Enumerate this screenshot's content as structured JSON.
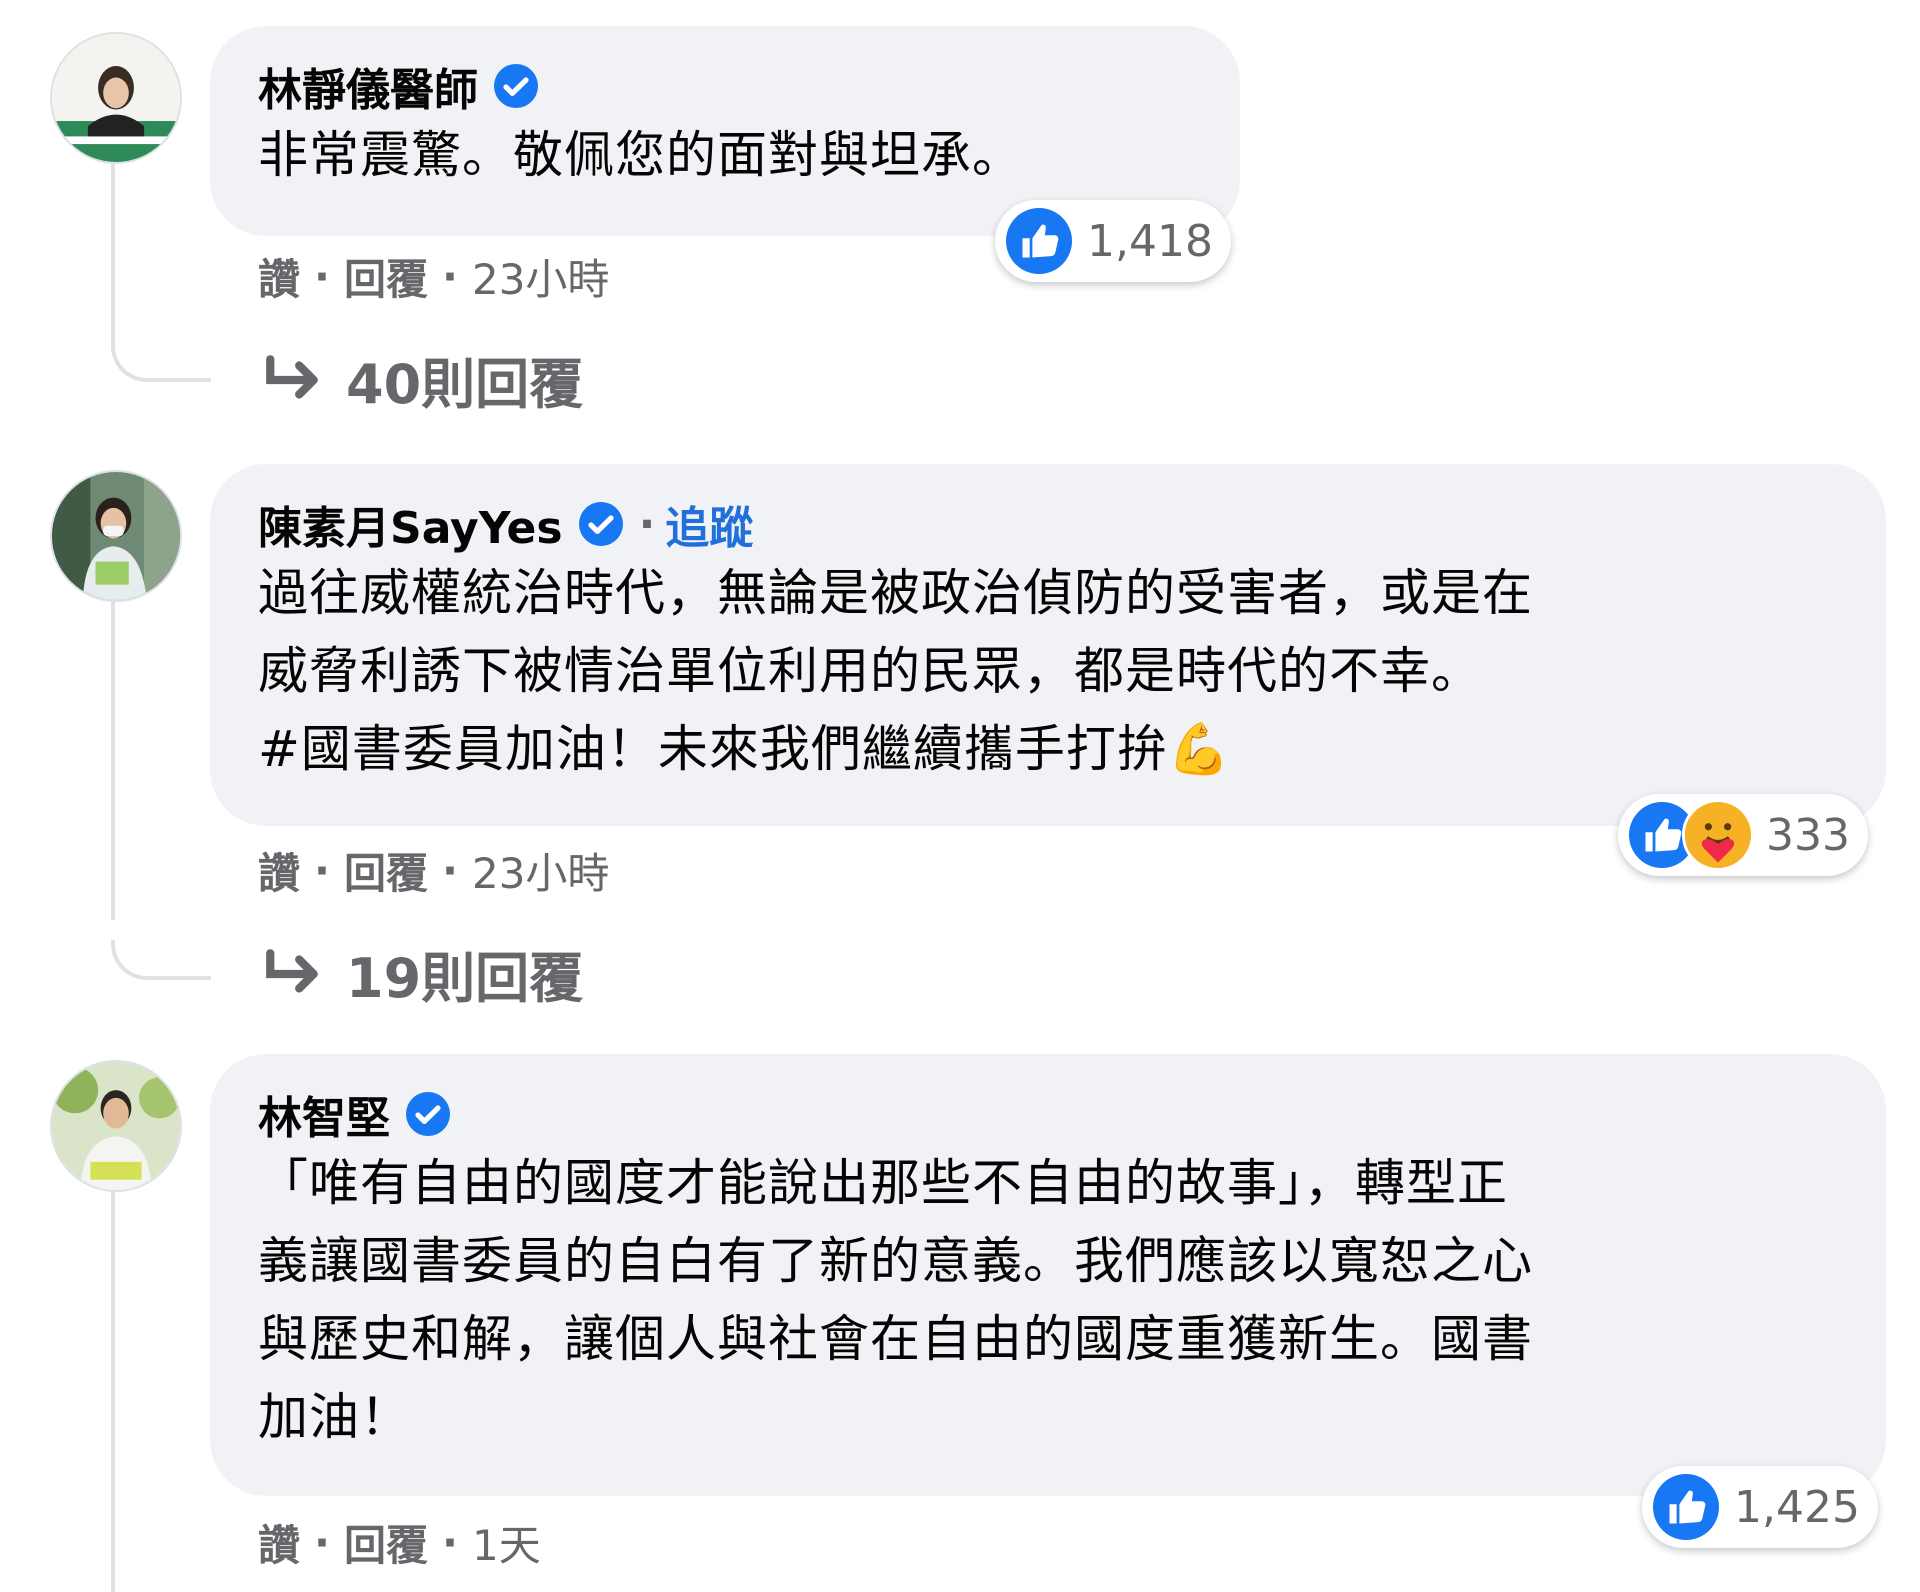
{
  "comments": [
    {
      "author": "林靜儀醫師",
      "verified": true,
      "follow_label": "",
      "text": "非常震驚。敬佩您的面對與坦承。",
      "reactions": {
        "icons": [
          "like-icon"
        ],
        "count": "1,418"
      },
      "actions": {
        "like": "讚",
        "reply": "回覆",
        "time": "23小時"
      },
      "replies_label": "40則回覆"
    },
    {
      "author": "陳素月SayYes",
      "verified": true,
      "follow_label": "追蹤",
      "text": "過往威權統治時代，無論是被政治偵防的受害者，或是在\n威脅利誘下被情治單位利用的民眾，都是時代的不幸。\n#國書委員加油！未來我們繼續攜手打拚💪",
      "reactions": {
        "icons": [
          "like-icon",
          "care-icon"
        ],
        "count": "333"
      },
      "actions": {
        "like": "讚",
        "reply": "回覆",
        "time": "23小時"
      },
      "replies_label": "19則回覆"
    },
    {
      "author": "林智堅",
      "verified": true,
      "follow_label": "",
      "text": "「唯有自由的國度才能說出那些不自由的故事」，轉型正\n義讓國書委員的自白有了新的意義。我們應該以寬恕之心\n與歷史和解，讓個人與社會在自由的國度重獲新生。國書\n加油！",
      "reactions": {
        "icons": [
          "like-icon"
        ],
        "count": "1,425"
      },
      "actions": {
        "like": "讚",
        "reply": "回覆",
        "time": "1天"
      },
      "replies_label": ""
    }
  ],
  "colors": {
    "bubble": "#f0f2f5",
    "link_blue": "#216fdb",
    "like_blue": "#1877f2",
    "secondary_text": "#65676b",
    "care_yellow": "#f7b125"
  },
  "separator": "·"
}
